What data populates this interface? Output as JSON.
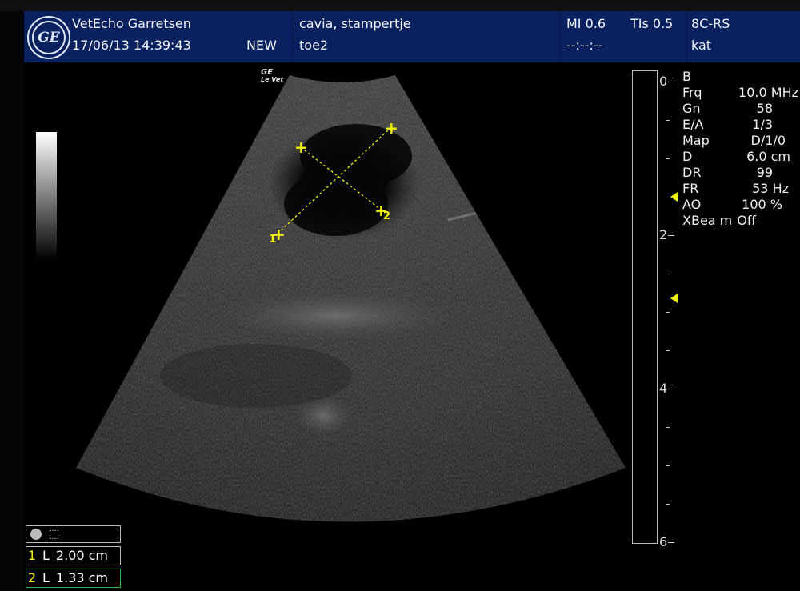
{
  "header": {
    "logo_text": "GE",
    "clinic": "VetEcho Garretsen",
    "datetime": "17/06/13 14:39:43",
    "status": "NEW",
    "patient": "cavia, stampertje",
    "exam": "toe2",
    "mi": "MI 0.6",
    "tis": "TIs 0.5",
    "time_placeholder": "--:--:--",
    "probe": "8C-RS",
    "preset": "kat"
  },
  "brand": {
    "line1": "GE",
    "line2": "Le Vet"
  },
  "markers": {
    "a_start": "+",
    "a_end": "+",
    "b_start": "+",
    "b_end": "+",
    "label1": "1",
    "label2": "2"
  },
  "depth_scale": {
    "labels": [
      "0",
      "2",
      "4",
      "6"
    ],
    "unit_hint": "cm"
  },
  "params": [
    {
      "key": "B",
      "value": ""
    },
    {
      "key": "Frq",
      "value": "10.0 MHz"
    },
    {
      "key": "Gn",
      "value": "58"
    },
    {
      "key": "E/A",
      "value": "1/3"
    },
    {
      "key": "Map",
      "value": "D/1/0"
    },
    {
      "key": "D",
      "value": "6.0 cm"
    },
    {
      "key": "DR",
      "value": "99"
    },
    {
      "key": "FR",
      "value": "53 Hz"
    },
    {
      "key": "AO",
      "value": "100 %"
    },
    {
      "key": "XBea m",
      "value": "Off"
    }
  ],
  "measurements": [
    {
      "index": "1",
      "type": "L",
      "value": "2.00 cm",
      "color": "#f2f200"
    },
    {
      "index": "2",
      "type": "L",
      "value": "1.33 cm",
      "color": "#27c02a"
    }
  ],
  "colors": {
    "header_bg": "#0a2160",
    "caliper": "#f2f200",
    "measurement2_border": "#27c02a"
  }
}
